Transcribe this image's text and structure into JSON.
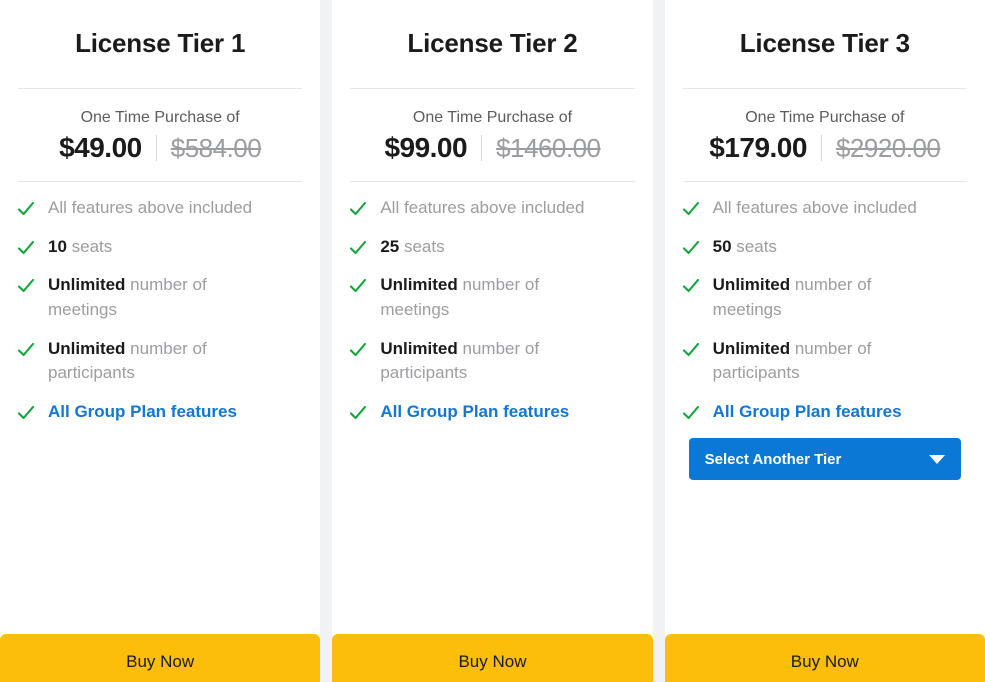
{
  "colors": {
    "accent_blue": "#1176d4",
    "dropdown_blue": "#0a78d4",
    "check_green": "#0fa53a",
    "buy_amber": "#fcbd0b",
    "muted_text": "#9c9da0",
    "dark_text": "#1b1b1b",
    "gutter": "#f1f2f4",
    "divider": "#e6e7e9"
  },
  "icons": {
    "check": "check-icon",
    "caret": "chevron-down-icon"
  },
  "tiers": [
    {
      "title": "License Tier 1",
      "price_caption": "One Time Purchase of",
      "price_current": "$49.00",
      "price_original": "$584.00",
      "features": [
        {
          "bold": "",
          "text": "All features above included"
        },
        {
          "bold": "10",
          "text": " seats"
        },
        {
          "bold": "Unlimited",
          "text": " number of meetings"
        },
        {
          "bold": "Unlimited",
          "text": " number of participants"
        }
      ],
      "link_label": "All Group Plan features",
      "has_select": false,
      "select_label": "",
      "buy_label": "Buy Now"
    },
    {
      "title": "License Tier 2",
      "price_caption": "One Time Purchase of",
      "price_current": "$99.00",
      "price_original": "$1460.00",
      "features": [
        {
          "bold": "",
          "text": "All features above included"
        },
        {
          "bold": "25",
          "text": " seats"
        },
        {
          "bold": "Unlimited",
          "text": " number of meetings"
        },
        {
          "bold": "Unlimited",
          "text": " number of participants"
        }
      ],
      "link_label": "All Group Plan features",
      "has_select": false,
      "select_label": "",
      "buy_label": "Buy Now"
    },
    {
      "title": "License Tier 3",
      "price_caption": "One Time Purchase of",
      "price_current": "$179.00",
      "price_original": "$2920.00",
      "features": [
        {
          "bold": "",
          "text": "All features above included"
        },
        {
          "bold": "50",
          "text": " seats"
        },
        {
          "bold": "Unlimited",
          "text": " number of meetings"
        },
        {
          "bold": "Unlimited",
          "text": " number of participants"
        }
      ],
      "link_label": "All Group Plan features",
      "has_select": true,
      "select_label": "Select Another Tier",
      "buy_label": "Buy Now"
    }
  ]
}
